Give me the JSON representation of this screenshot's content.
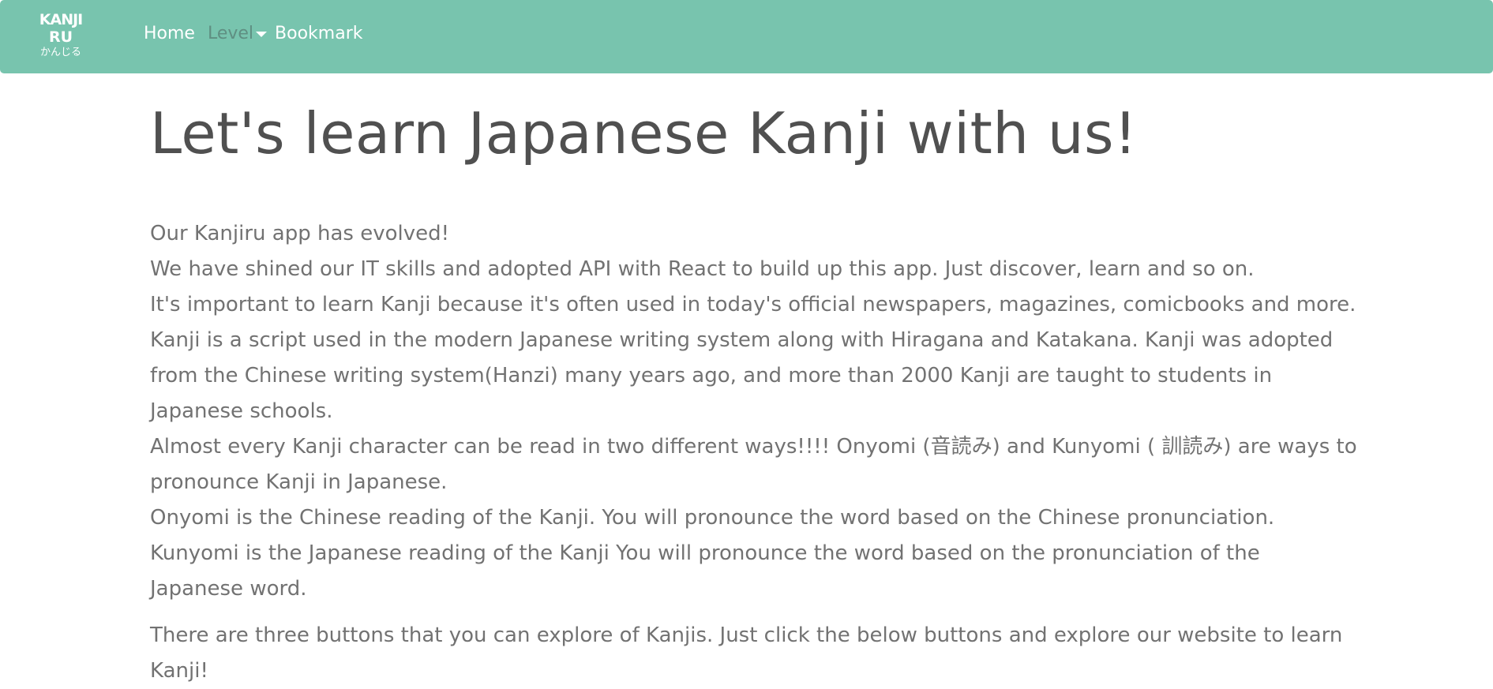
{
  "nav": {
    "logo_line1": "KANJI",
    "logo_line2": "RU",
    "logo_line3": "かんじる",
    "home": "Home",
    "level": "Level",
    "bookmark": "Bookmark"
  },
  "colors": {
    "navbar_bg": "#78c4ae",
    "text": "#727272",
    "heading": "#505050"
  },
  "main": {
    "title": "Let's learn Japanese Kanji with us!",
    "paragraphs": [
      "Our Kanjiru app has evolved!",
      "We have shined our IT skills and adopted API with React to build up this app. Just discover, learn and so on.",
      "It's important to learn Kanji because it's often used in today's official newspapers, magazines, comicbooks and more. Kanji is a script used in the modern Japanese writing system along with Hiragana and Katakana. Kanji was adopted from the Chinese writing system(Hanzi) many years ago, and more than 2000 Kanji are taught to students in Japanese schools.",
      "Almost every Kanji character can be read in two different ways!!!! Onyomi (音読み) and Kunyomi ( 訓読み) are ways to pronounce Kanji in Japanese.",
      "Onyomi is the Chinese reading of the Kanji. You will pronounce the word based on the Chinese pronunciation.",
      "Kunyomi is the Japanese reading of the Kanji You will pronounce the word based on the pronunciation of the Japanese word."
    ],
    "footer_paragraph": "There are three buttons that you can explore of Kanjis. Just click the below buttons and explore our website to learn Kanji!"
  }
}
